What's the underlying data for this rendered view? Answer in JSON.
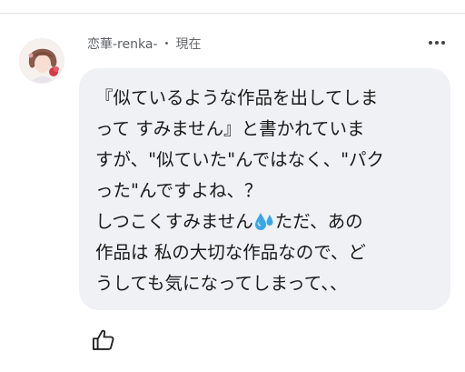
{
  "comment": {
    "author": "恋華-renka-",
    "separator": "・",
    "time": "現在",
    "lines": [
      "『似ているような作品を出してしま",
      "って すみません』と書かれていま",
      "すが、\"似ていた\"んではなく、\"パク",
      "った\"んですよね、？",
      "しつこくすみません",
      "ただ、あの",
      "作品は 私の大切な作品なので、ど",
      "うしても気になってしまって、、"
    ]
  },
  "icons": {
    "avatar": "avatar-image",
    "more": "more-horizontal-icon",
    "sweat": "sweat-droplets-emoji",
    "like": "thumbs-up-icon"
  },
  "colors": {
    "bubble": "#eff1f4",
    "meta_text": "#65676b",
    "body_text": "#1a1a1a",
    "emoji_blue": "#3aa7e6"
  }
}
